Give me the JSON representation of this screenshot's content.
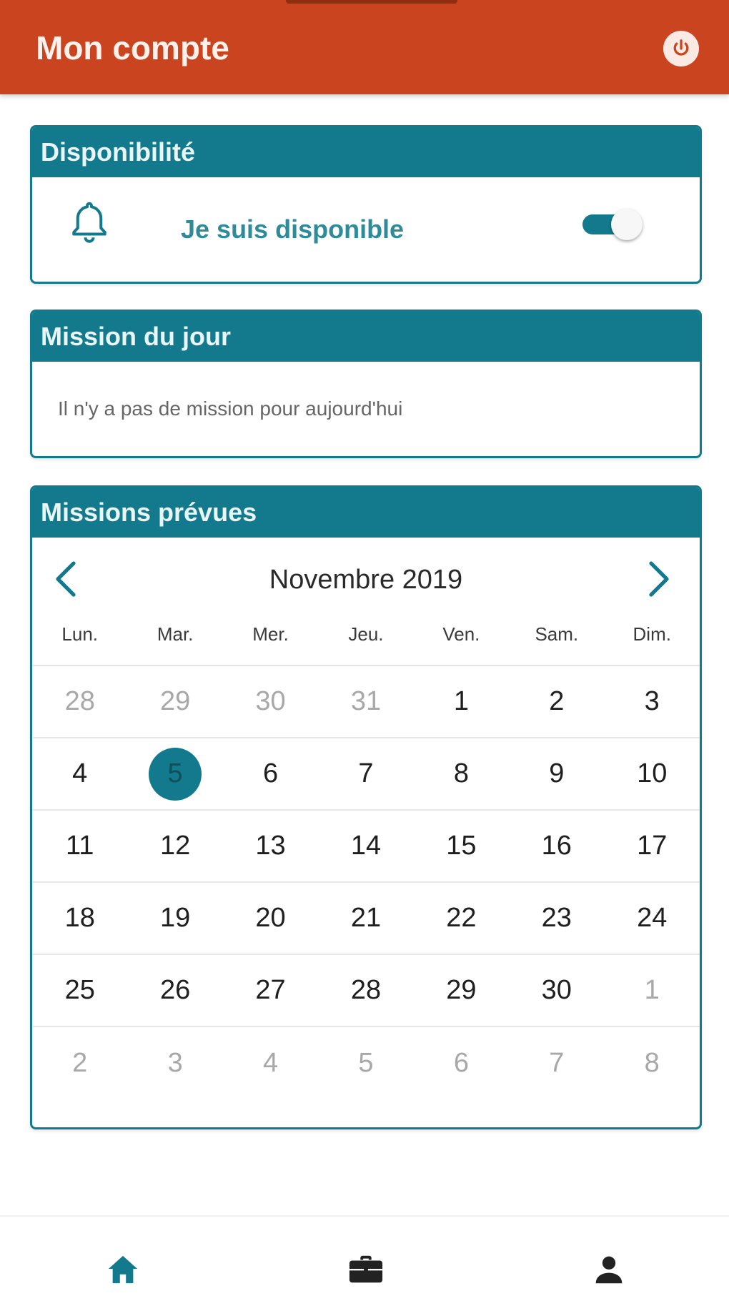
{
  "header": {
    "title": "Mon compte",
    "power_icon": "power-icon"
  },
  "availability": {
    "title": "Disponibilité",
    "label": "Je suis disponible",
    "icon": "bell-icon",
    "enabled": true
  },
  "mission_today": {
    "title": "Mission du jour",
    "message": "Il n'y a pas de mission pour aujourd'hui"
  },
  "planned": {
    "title": "Missions prévues",
    "month_label": "Novembre 2019",
    "weekdays": [
      "Lun.",
      "Mar.",
      "Mer.",
      "Jeu.",
      "Ven.",
      "Sam.",
      "Dim."
    ],
    "weeks": [
      [
        {
          "d": "28",
          "m": true
        },
        {
          "d": "29",
          "m": true
        },
        {
          "d": "30",
          "m": true
        },
        {
          "d": "31",
          "m": true
        },
        {
          "d": "1"
        },
        {
          "d": "2"
        },
        {
          "d": "3"
        }
      ],
      [
        {
          "d": "4"
        },
        {
          "d": "5",
          "s": true
        },
        {
          "d": "6"
        },
        {
          "d": "7"
        },
        {
          "d": "8"
        },
        {
          "d": "9"
        },
        {
          "d": "10"
        }
      ],
      [
        {
          "d": "11"
        },
        {
          "d": "12"
        },
        {
          "d": "13"
        },
        {
          "d": "14"
        },
        {
          "d": "15"
        },
        {
          "d": "16"
        },
        {
          "d": "17"
        }
      ],
      [
        {
          "d": "18"
        },
        {
          "d": "19"
        },
        {
          "d": "20"
        },
        {
          "d": "21"
        },
        {
          "d": "22"
        },
        {
          "d": "23"
        },
        {
          "d": "24"
        }
      ],
      [
        {
          "d": "25"
        },
        {
          "d": "26"
        },
        {
          "d": "27"
        },
        {
          "d": "28"
        },
        {
          "d": "29"
        },
        {
          "d": "30"
        },
        {
          "d": "1",
          "m": true
        }
      ],
      [
        {
          "d": "2",
          "m": true
        },
        {
          "d": "3",
          "m": true
        },
        {
          "d": "4",
          "m": true
        },
        {
          "d": "5",
          "m": true
        },
        {
          "d": "6",
          "m": true
        },
        {
          "d": "7",
          "m": true
        },
        {
          "d": "8",
          "m": true
        }
      ]
    ]
  },
  "bottom_nav": {
    "items": [
      {
        "icon": "home-icon",
        "active": true
      },
      {
        "icon": "briefcase-icon",
        "active": false
      },
      {
        "icon": "user-icon",
        "active": false
      }
    ]
  },
  "colors": {
    "header": "#c9441f",
    "accent": "#127a8c"
  }
}
